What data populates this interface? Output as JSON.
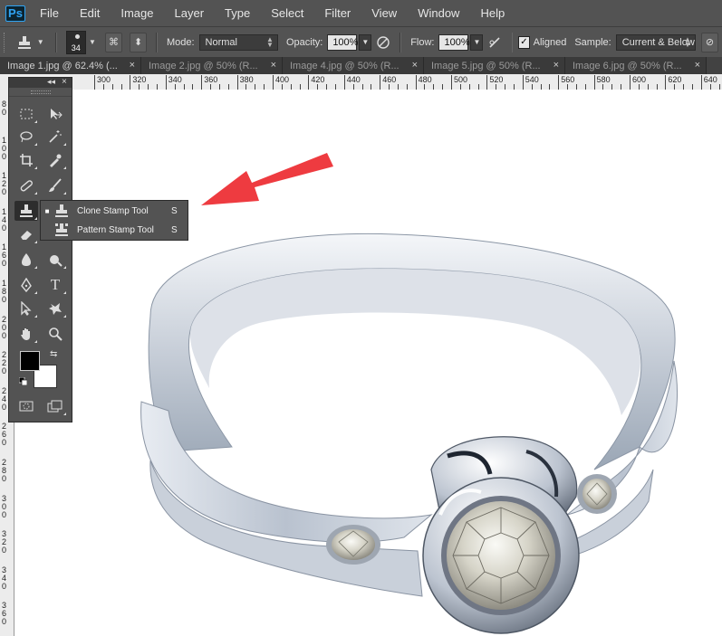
{
  "app": {
    "logo": "Ps"
  },
  "menu": [
    "File",
    "Edit",
    "Image",
    "Layer",
    "Type",
    "Select",
    "Filter",
    "View",
    "Window",
    "Help"
  ],
  "options": {
    "brush_size": "34",
    "mode_label": "Mode:",
    "mode_value": "Normal",
    "opacity_label": "Opacity:",
    "opacity_value": "100%",
    "flow_label": "Flow:",
    "flow_value": "100%",
    "aligned_label": "Aligned",
    "sample_label": "Sample:",
    "sample_value": "Current & Below"
  },
  "tabs": [
    "Image 1.jpg @ 62.4% (...",
    "Image 2.jpg @ 50% (R...",
    "Image 4.jpg @ 50% (R...",
    "Image 5.jpg @ 50% (R...",
    "Image 6.jpg @ 50% (R..."
  ],
  "ruler": {
    "h_labels": [
      "300",
      "320",
      "340",
      "360",
      "380",
      "400",
      "420",
      "440",
      "460",
      "480",
      "500",
      "520",
      "540",
      "560",
      "580",
      "600",
      "620",
      "640"
    ],
    "v_labels": [
      "80",
      "100",
      "120",
      "140",
      "160",
      "180",
      "200",
      "220",
      "240",
      "260",
      "280",
      "300",
      "320",
      "340",
      "360"
    ]
  },
  "flyout": {
    "items": [
      {
        "label": "Clone Stamp Tool",
        "key": "S",
        "selected": true
      },
      {
        "label": "Pattern Stamp Tool",
        "key": "S",
        "selected": false
      }
    ]
  },
  "colors": {
    "foreground": "#000000",
    "background": "#ffffff",
    "annotation_arrow": "#ee3b40"
  }
}
